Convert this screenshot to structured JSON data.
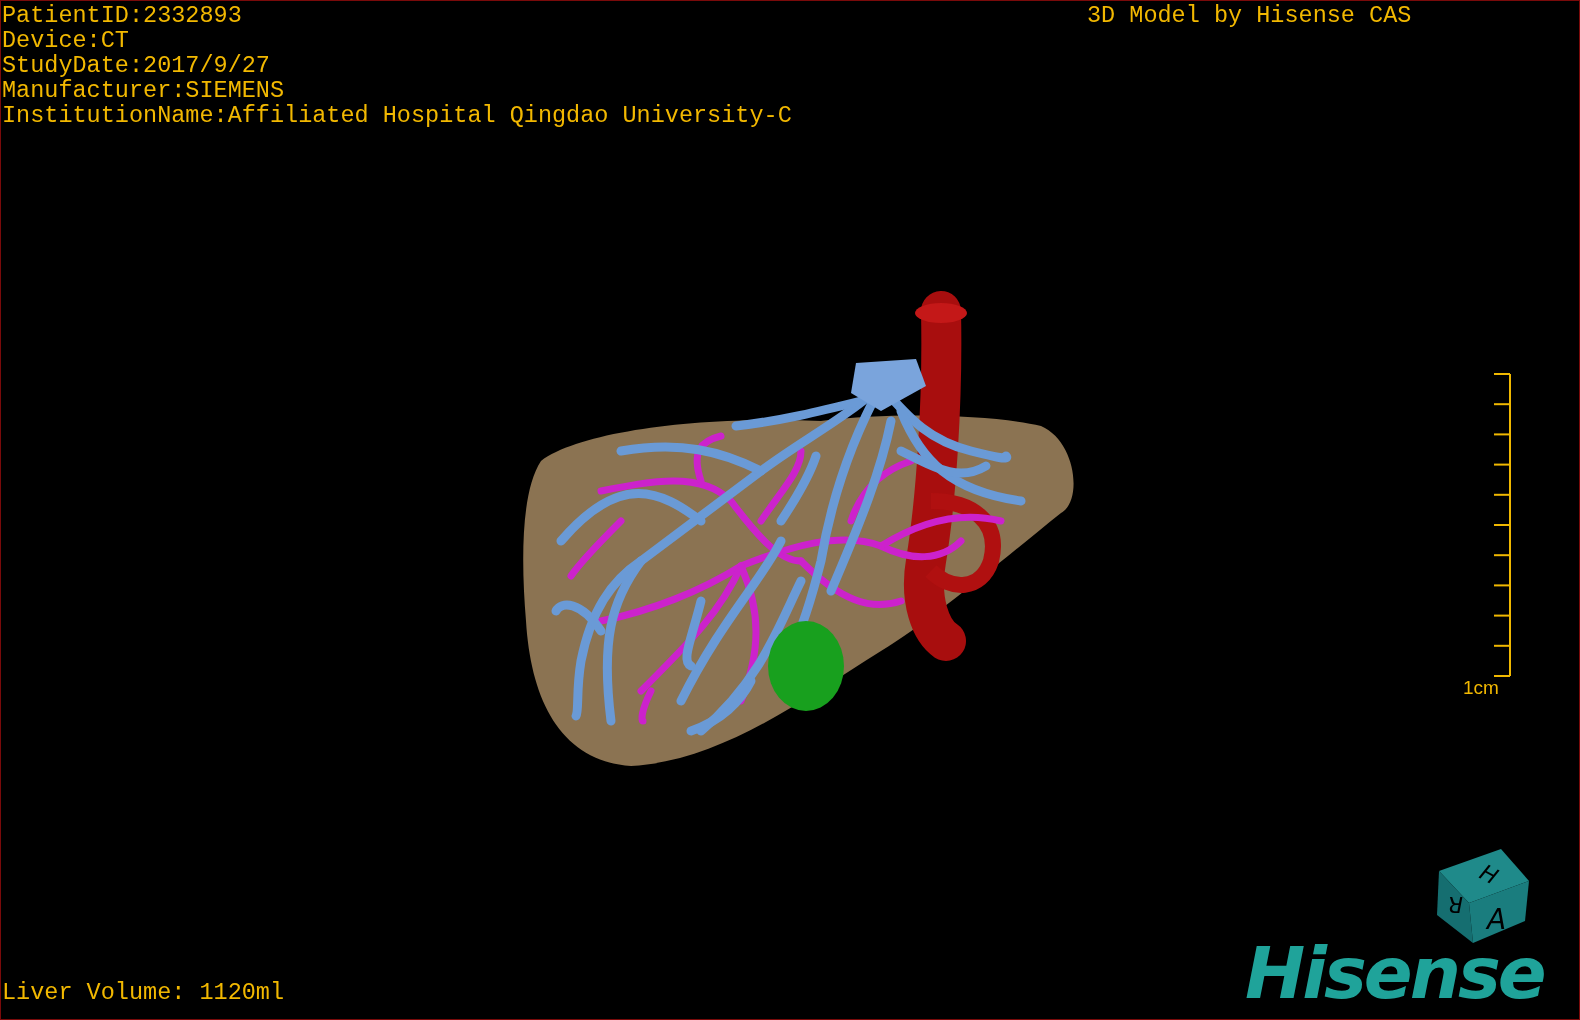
{
  "patient_info": [
    "PatientID:2332893",
    "Device:CT",
    "StudyDate:2017/9/27",
    "Manufacturer:SIEMENS",
    "InstitutionName:Affiliated Hospital Qingdao University-C"
  ],
  "title": "3D Model by Hisense CAS",
  "scale_bar": {
    "label": "1cm"
  },
  "orientation_cube": {
    "faces": [
      "H",
      "R",
      "A"
    ]
  },
  "logo": "Hisense",
  "liver_volume": "Liver Volume: 1120ml"
}
